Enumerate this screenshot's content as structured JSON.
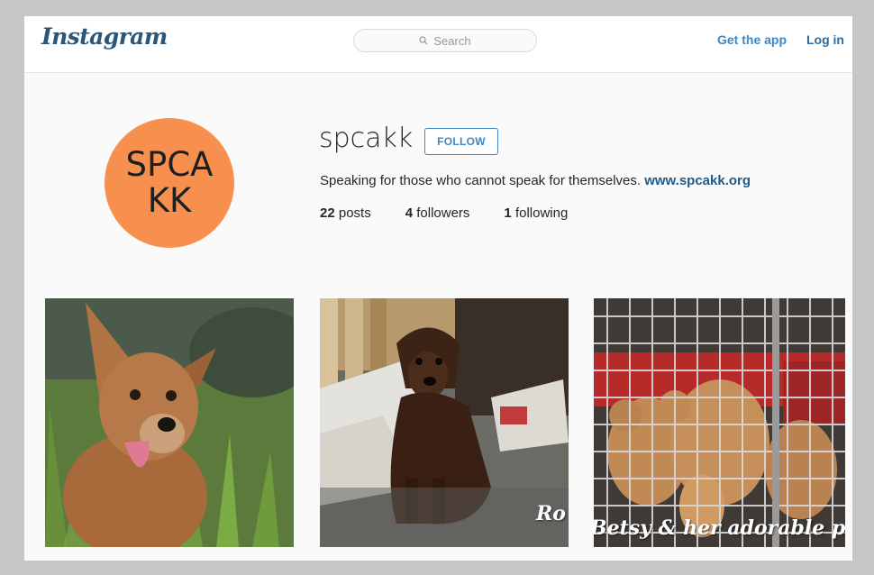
{
  "header": {
    "logo_text": "Instagram",
    "search_placeholder": "Search",
    "get_app_label": "Get the app",
    "login_label": "Log in"
  },
  "profile": {
    "avatar_line1": "SPCA",
    "avatar_line2": "KK",
    "username": "spcakk",
    "follow_label": "FOLLOW",
    "bio_text": "Speaking for those who cannot speak for themselves. ",
    "bio_link": "www.spcakk.org",
    "posts_count": "22",
    "posts_label": "posts",
    "followers_count": "4",
    "followers_label": "followers",
    "following_count": "1",
    "following_label": "following"
  },
  "posts": [
    {
      "caption": ""
    },
    {
      "caption": "Ro"
    },
    {
      "caption": "Betsy & her adorable pupp"
    }
  ],
  "colors": {
    "page_bg": "#c5c6c5",
    "accent_blue": "#3f87c4",
    "avatar_orange": "#f7904f"
  }
}
